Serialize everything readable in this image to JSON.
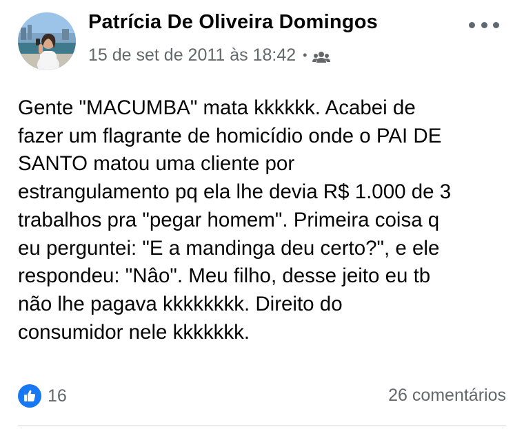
{
  "post": {
    "author": "Patrícia De Oliveira Domingos",
    "timestamp": "15 de set de 2011 às 18:42",
    "separator": "•",
    "audience_icon": "friends-icon",
    "more_icon": "more-options-icon",
    "text_lines": [
      "Gente \"MACUMBA\" mata kkkkkk. Acabei de",
      "fazer um flagrante de homicídio onde o PAI DE",
      "SANTO matou uma cliente por",
      "estrangulamento pq ela lhe devia R$ 1.000 de 3",
      "trabalhos pra \"pegar homem\". Primeira coisa q",
      "eu perguntei: \"E a mandinga deu certo?\", e ele",
      "respondeu: \"Nâo\". Meu filho, desse jeito eu tb",
      "não lhe pagava kkkkkkkk. Direito do",
      "consumidor nele kkkkkkk."
    ],
    "reactions": {
      "icon": "like-icon",
      "count": "16"
    },
    "comments": "26 comentários"
  },
  "colors": {
    "primary_text": "#050505",
    "secondary_text": "#65676b",
    "like_blue": "#1877f2",
    "divider": "#ced0d4"
  }
}
